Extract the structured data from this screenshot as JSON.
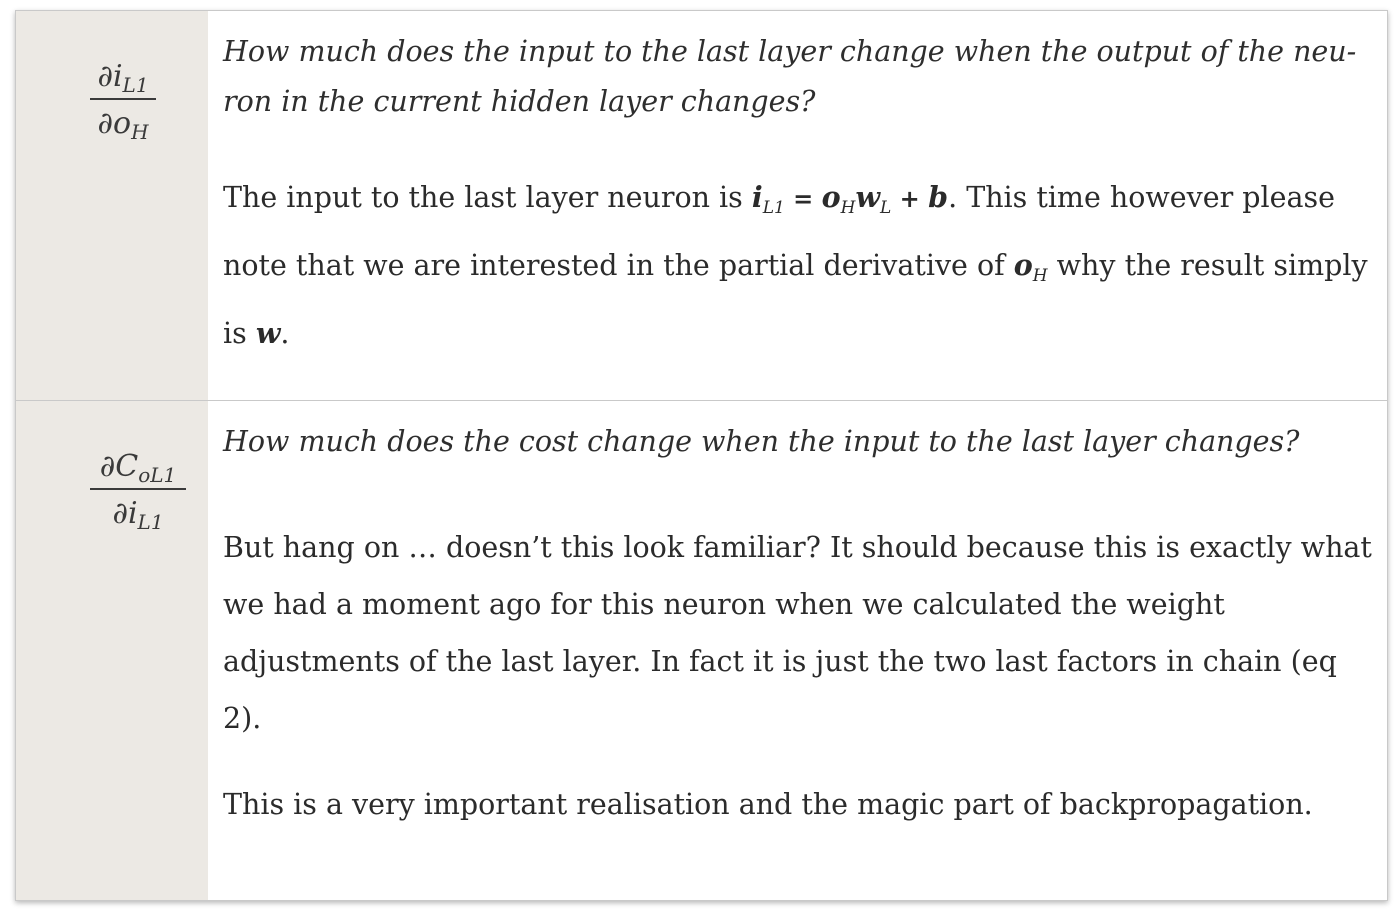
{
  "rows": [
    {
      "formula": {
        "numerator_symbol": "∂i",
        "numerator_sub": "L1",
        "denominator_symbol": "∂o",
        "denominator_sub": "H"
      },
      "question": "How much does the input to the last layer change when the output of the neu-ron in the current hidden layer changes?",
      "question_line1": "How much does the input to the last layer change when the output of the neu-",
      "question_line2": "ron in the current hidden layer changes?",
      "paragraph": {
        "t1": "The input to the last layer neuron is ",
        "m1": "i",
        "m1_sub": "L1",
        "t2": " = ",
        "m2": "o",
        "m2_sub": "H",
        "m3": "w",
        "m3_sub": "L",
        "t3": " + ",
        "m4": "b",
        "t4": ". This time however please note that we are interested in the partial derivative of ",
        "m5": "o",
        "m5_sub": "H",
        "t5": " why the result simply is ",
        "m6": "w",
        "t6": "."
      }
    },
    {
      "formula": {
        "numerator_symbol": "∂C",
        "numerator_sub": "oL1",
        "denominator_symbol": "∂i",
        "denominator_sub": "L1"
      },
      "question": "How much does the cost change when the input to the last layer changes?",
      "paragraph1": "But hang on … doesn’t this look familiar? It should because this is exactly what we had a moment ago for this neuron when we calculated the weight adjustments of the last layer. In fact it is just the two last factors in chain (eq 2).",
      "paragraph2": "This is a very important realisation and the magic part of backpropagation."
    }
  ]
}
